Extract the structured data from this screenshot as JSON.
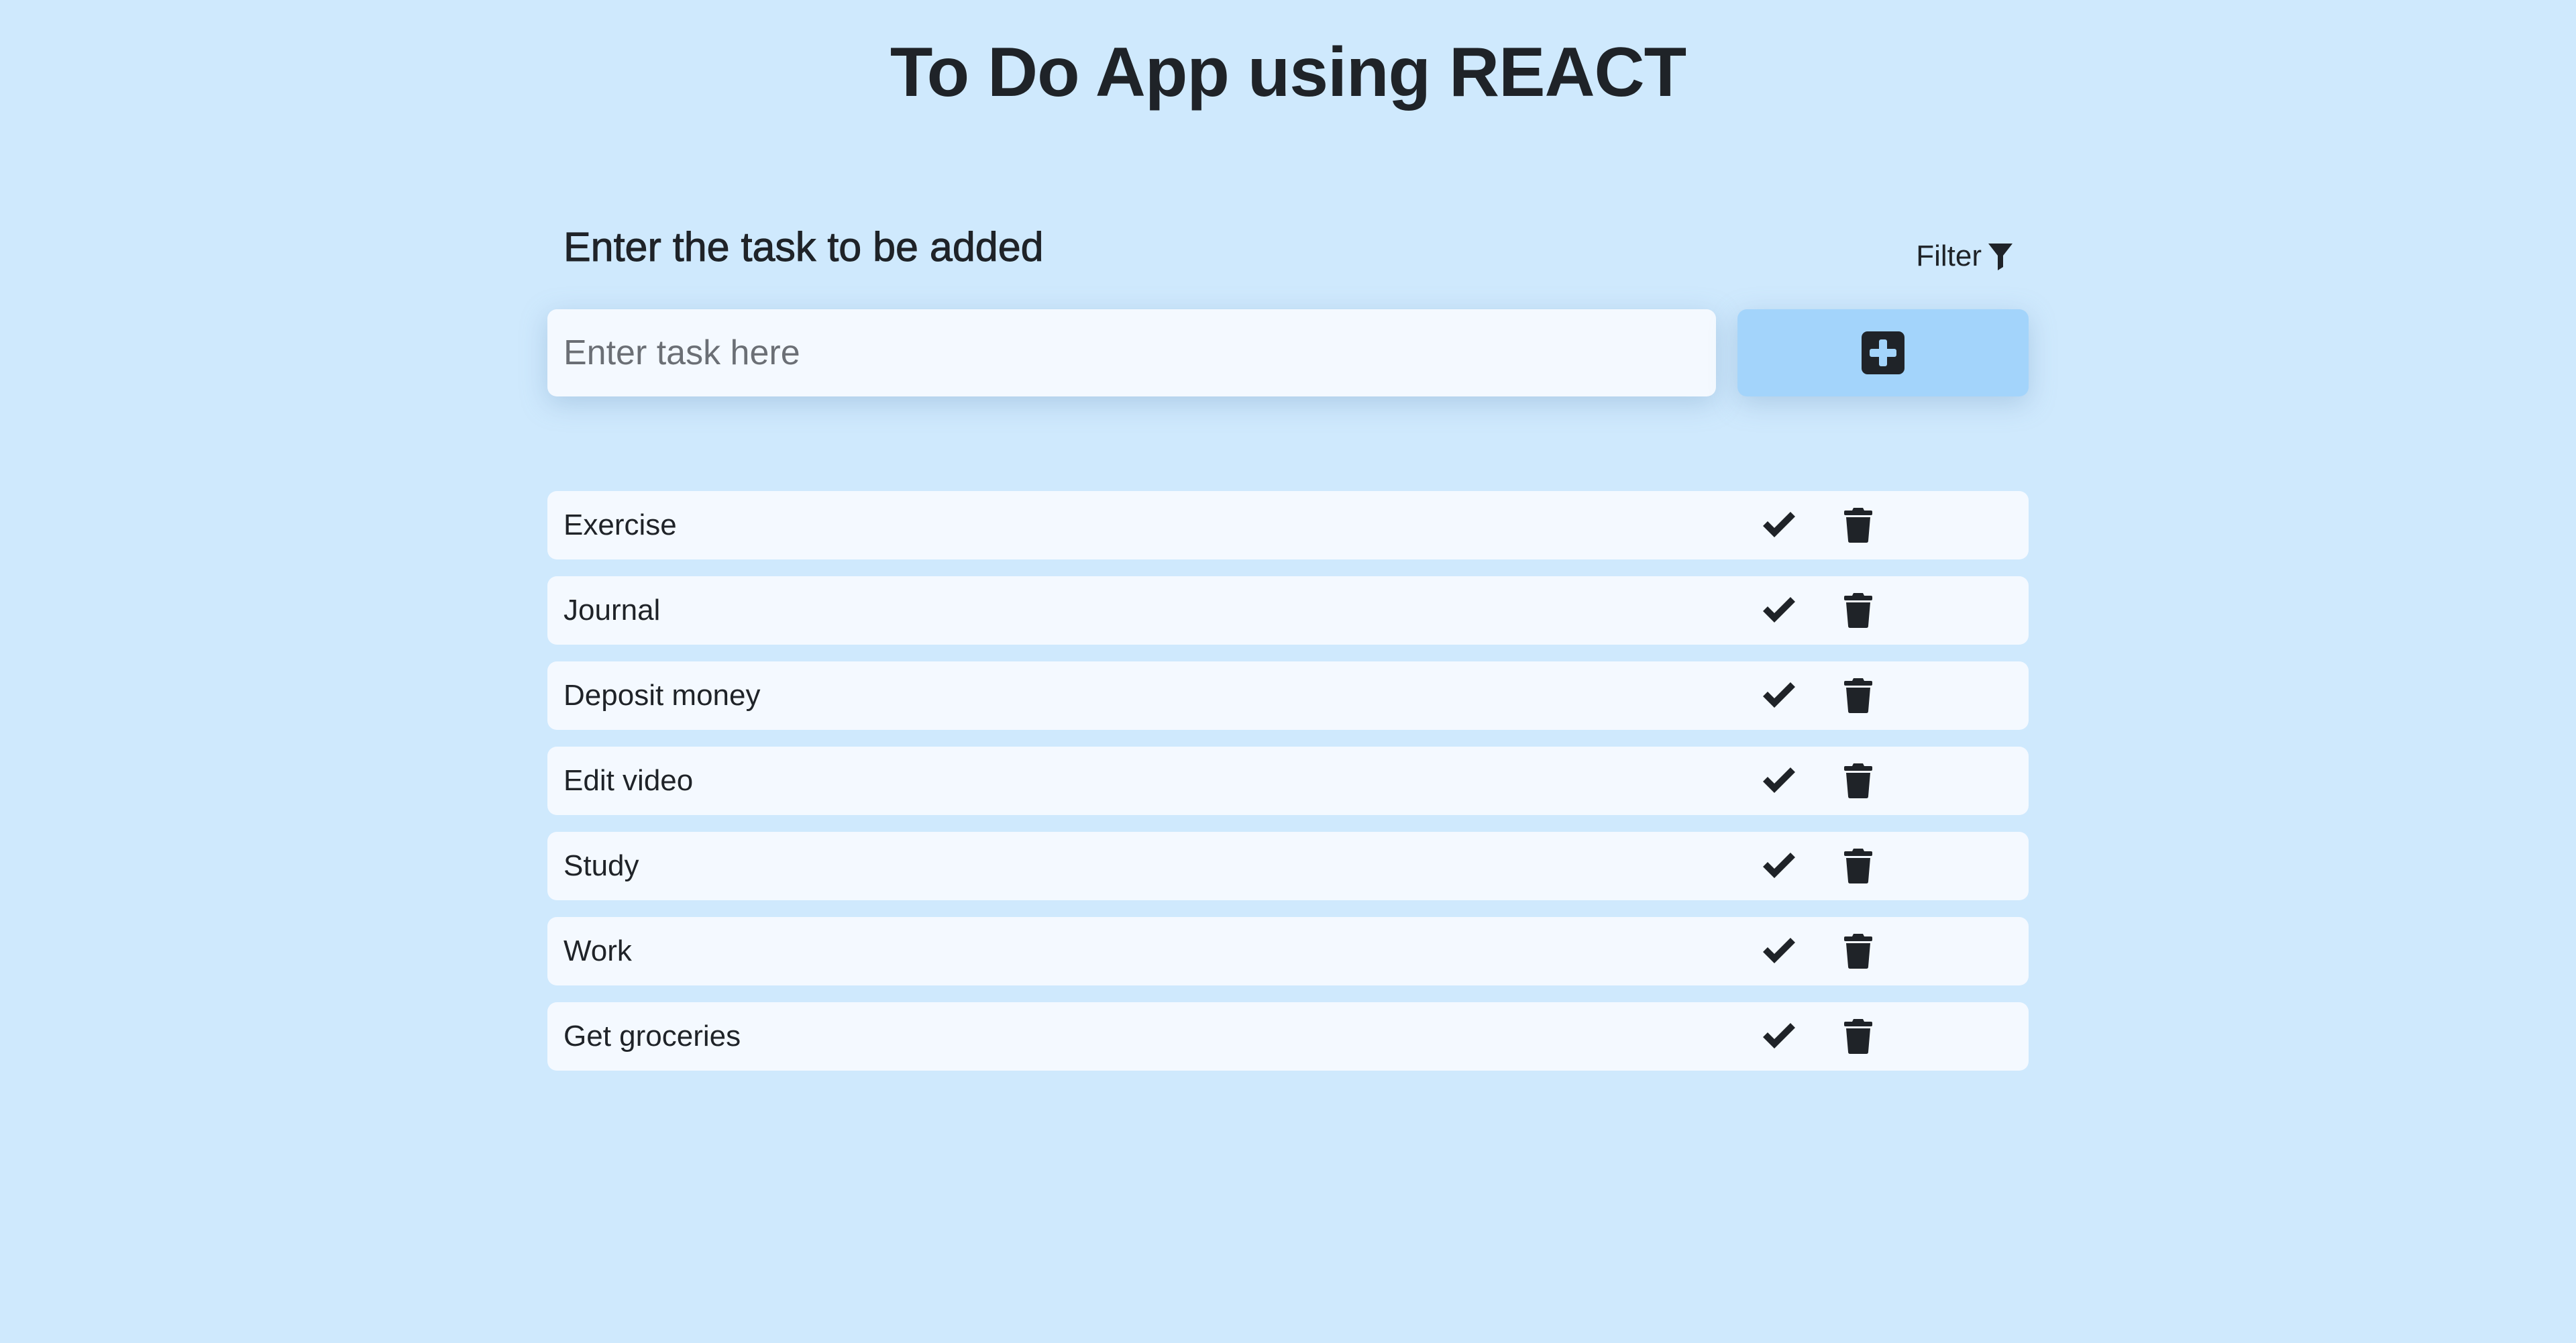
{
  "app": {
    "title": "To Do App using REACT"
  },
  "form": {
    "heading": "Enter the task to be added",
    "filter_label": "Filter",
    "filter_icon": "filter-icon",
    "input_value": "",
    "input_placeholder": "Enter task here",
    "add_icon": "plus-square-icon"
  },
  "tasks": [
    {
      "name": "Exercise"
    },
    {
      "name": "Journal"
    },
    {
      "name": "Deposit money"
    },
    {
      "name": "Edit video"
    },
    {
      "name": "Study"
    },
    {
      "name": "Work"
    },
    {
      "name": "Get groceries"
    }
  ],
  "task_actions": {
    "done_icon": "check-icon",
    "delete_icon": "trash-icon"
  },
  "colors": {
    "background": "#cfe9fd",
    "surface": "#f4f9ff",
    "add_button": "#a3d4fb",
    "text": "#1f2328"
  }
}
